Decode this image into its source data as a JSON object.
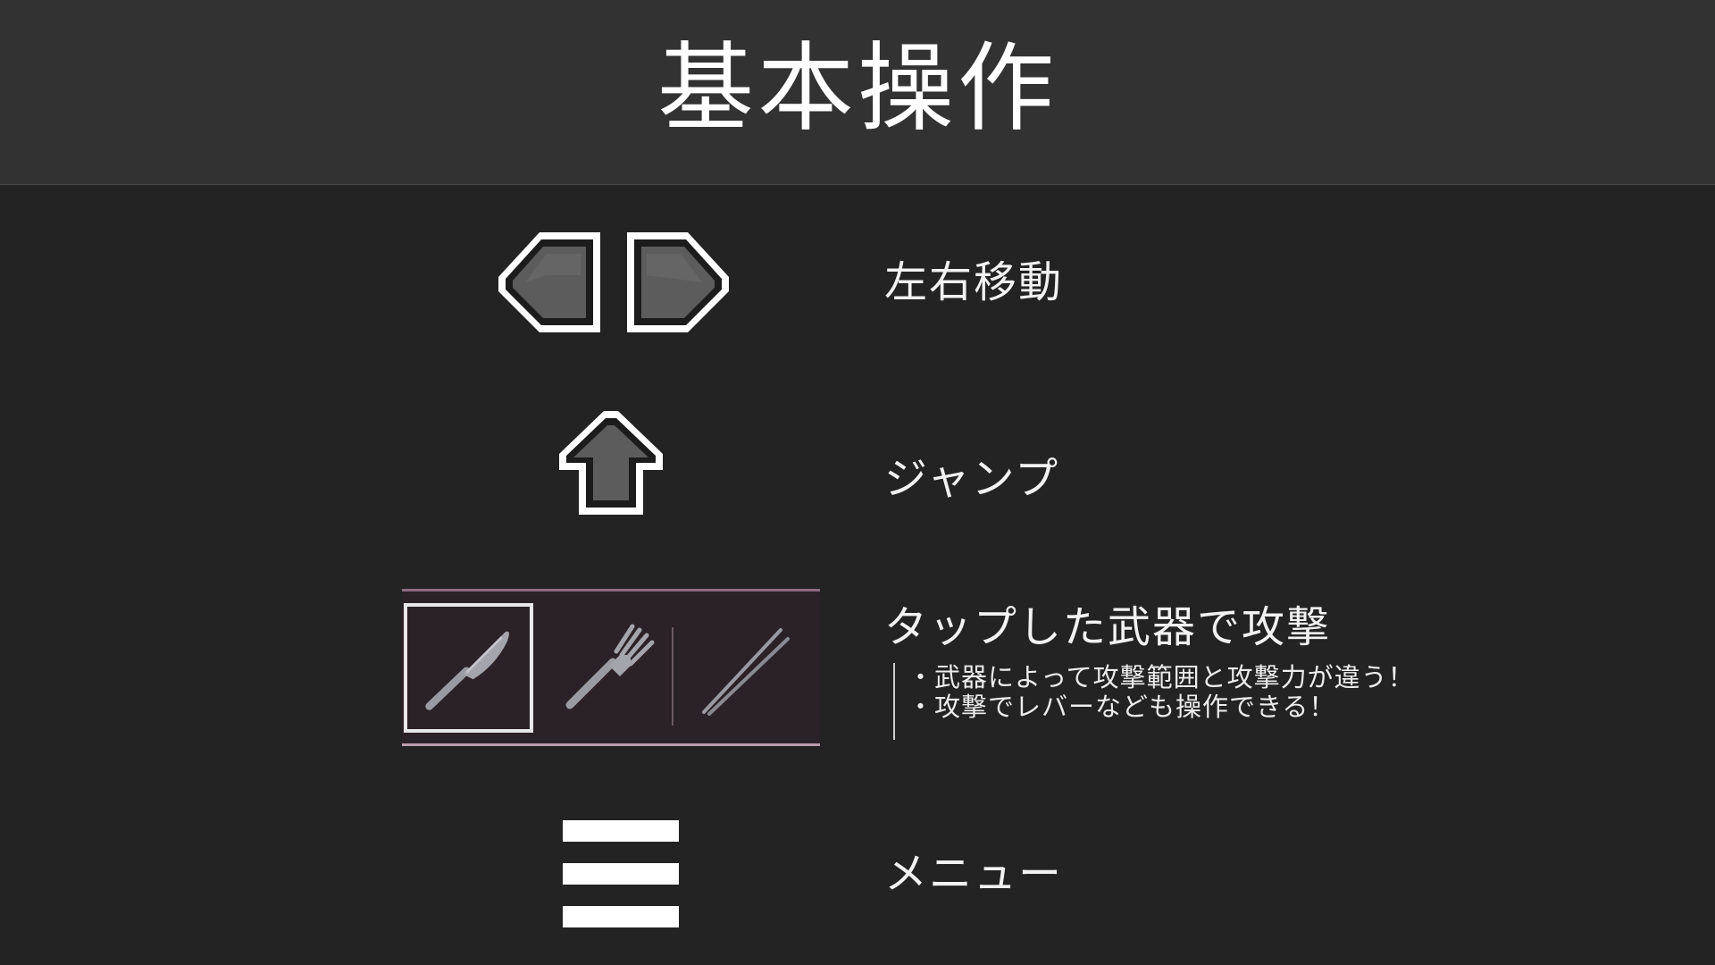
{
  "title": "基本操作",
  "controls": {
    "move": {
      "icon": "left-right-arrow-icons",
      "label": "左右移動"
    },
    "jump": {
      "icon": "up-arrow-icon",
      "label": "ジャンプ"
    },
    "attack": {
      "label": "タップした武器で攻撃",
      "notes": [
        "・武器によって攻撃範囲と攻撃力が違う！",
        "・攻撃でレバーなども操作できる！"
      ],
      "weapons": [
        {
          "name": "knife-icon",
          "selected": true
        },
        {
          "name": "fork-icon",
          "selected": false
        },
        {
          "name": "chopsticks-icon",
          "selected": false
        }
      ]
    },
    "menu": {
      "icon": "hamburger-menu-icon",
      "label": "メニュー"
    }
  },
  "colors": {
    "background": "#232323",
    "header": "#323232",
    "text": "#f2f2f2",
    "panel": "#2b2227",
    "panel_border": "#b99cac"
  }
}
